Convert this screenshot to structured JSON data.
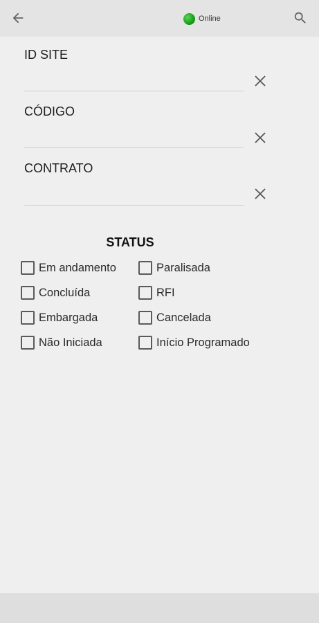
{
  "header": {
    "back_icon": "arrow-left-icon",
    "status_text": "Online",
    "status_color": "#1aa31a",
    "search_icon": "search-icon"
  },
  "fields": [
    {
      "label": "ID SITE",
      "value": "",
      "clear_icon": "close-icon"
    },
    {
      "label": "CÓDIGO",
      "value": "",
      "clear_icon": "close-icon"
    },
    {
      "label": "CONTRATO",
      "value": "",
      "clear_icon": "close-icon"
    }
  ],
  "status": {
    "title": "STATUS",
    "options": [
      {
        "label": "Em andamento",
        "checked": false
      },
      {
        "label": "Paralisada",
        "checked": false
      },
      {
        "label": "Concluída",
        "checked": false
      },
      {
        "label": "RFI",
        "checked": false
      },
      {
        "label": "Embargada",
        "checked": false
      },
      {
        "label": "Cancelada",
        "checked": false
      },
      {
        "label": "Não Iniciada",
        "checked": false
      },
      {
        "label": "Início Programado",
        "checked": false
      }
    ]
  }
}
